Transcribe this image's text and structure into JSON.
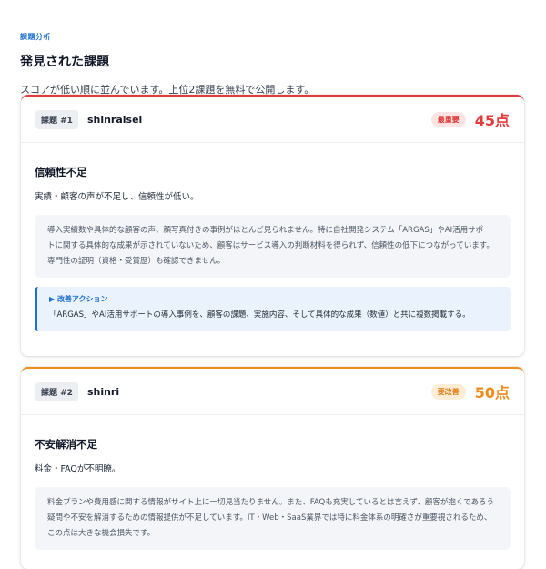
{
  "section": {
    "tag": "課題分析",
    "title": "発見された課題",
    "description": "スコアが低い順に並んでいます。上位2課題を無料で公開します。"
  },
  "colors": {
    "accent_blue": "#1d6fd1",
    "critical_red": "#e23b3b",
    "warning_orange": "#f08c1b"
  },
  "issues": [
    {
      "number": "課題 #1",
      "key": "shinraisei",
      "badge": "最重要",
      "score": "45点",
      "title": "信頼性不足",
      "summary": "実績・顧客の声が不足し、信頼性が低い。",
      "detail": "導入実績数や具体的な顧客の声、顔写真付きの事例がほとんど見られません。特に自社開発システム「ARGAS」やAI活用サポートに関する具体的な成果が示されていないため、顧客はサービス導入の判断材料を得られず、信頼性の低下につながっています。専門性の証明（資格・受賞歴）も確認できません。",
      "action_label": "▶ 改善アクション",
      "action": "「ARGAS」やAI活用サポートの導入事例を、顧客の課題、実施内容、そして具体的な成果（数値）と共に複数掲載する。"
    },
    {
      "number": "課題 #2",
      "key": "shinri",
      "badge": "要改善",
      "score": "50点",
      "title": "不安解消不足",
      "summary": "料金・FAQが不明瞭。",
      "detail": "料金プランや費用感に関する情報がサイト上に一切見当たりません。また、FAQも充実しているとは言えず、顧客が抱くであろう疑問や不安を解消するための情報提供が不足しています。IT・Web・SaaS業界では特に料金体系の明確さが重要視されるため、この点は大きな機会損失です。"
    }
  ]
}
